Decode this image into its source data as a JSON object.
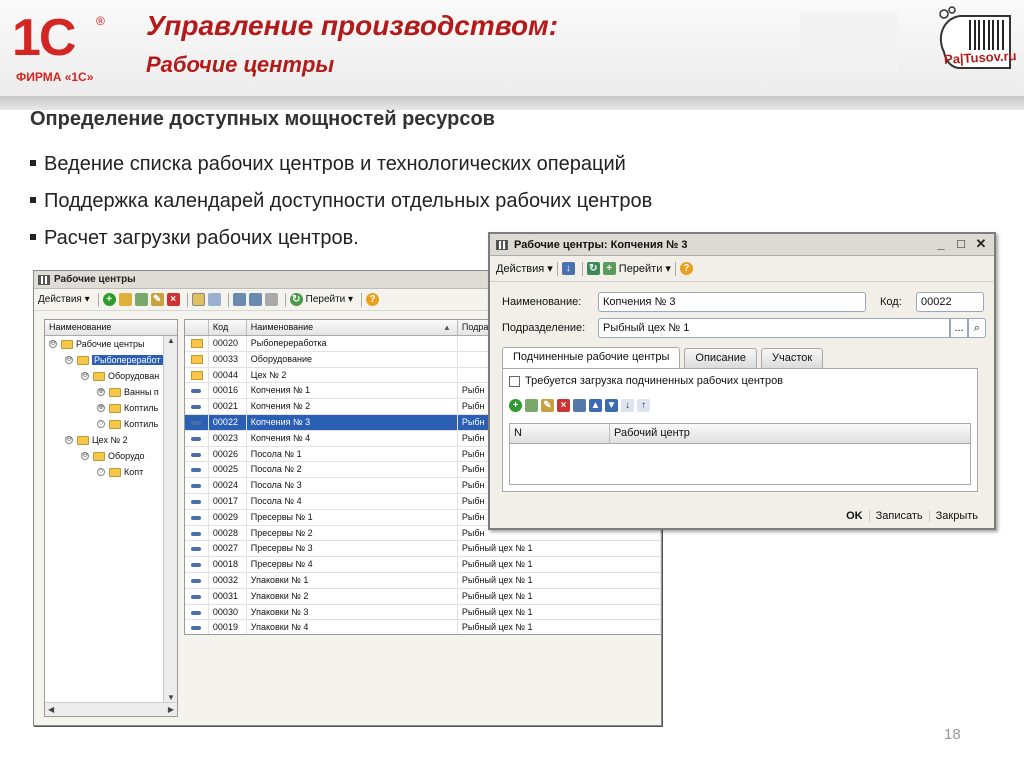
{
  "slide": {
    "logo_text": "1С",
    "logo_reg": "®",
    "logo_caption": "ФИРМА «1С»",
    "title": "Управление производством:",
    "subtitle": "Рабочие центры",
    "brand_text": "Pa|Tusov.ru",
    "section_title": "Определение доступных мощностей ресурсов",
    "bullets": [
      "Ведение списка рабочих центров и технологических операций",
      "Поддержка календарей доступности отдельных рабочих центров",
      "Расчет загрузки рабочих центров."
    ],
    "page_number": "18",
    "accent_color": "#b31b1b"
  },
  "list_window": {
    "title": "Рабочие центры",
    "toolbar": {
      "actions": "Действия",
      "goto": "Перейти"
    },
    "tree_header": "Наименование",
    "tree": [
      {
        "label": "Рабочие центры",
        "toggle": "⊖",
        "level": 0,
        "selected": false
      },
      {
        "label": "Рыбопереработ",
        "toggle": "⊖",
        "level": 1,
        "selected": true
      },
      {
        "label": "Оборудован",
        "toggle": "⊖",
        "level": 2,
        "selected": false
      },
      {
        "label": "Ванны п",
        "toggle": "⊕",
        "level": 3,
        "selected": false
      },
      {
        "label": "Коптиль",
        "toggle": "⊕",
        "level": 3,
        "selected": false
      },
      {
        "label": "Коптиль",
        "toggle": "○",
        "level": 3,
        "selected": false
      },
      {
        "label": "Цех № 2",
        "toggle": "⊖",
        "level": 1,
        "selected": false
      },
      {
        "label": "Оборудо",
        "toggle": "⊖",
        "level": 2,
        "selected": false
      },
      {
        "label": "Копт",
        "toggle": "○",
        "level": 3,
        "selected": false
      }
    ],
    "grid_headers": [
      "Код",
      "Наименование",
      "Подра"
    ],
    "rows": [
      {
        "icon": "folder",
        "code": "00020",
        "name": "Рыбопереработка",
        "division": ""
      },
      {
        "icon": "folder",
        "code": "00033",
        "name": "Оборудование",
        "division": ""
      },
      {
        "icon": "folder",
        "code": "00044",
        "name": "Цех № 2",
        "division": ""
      },
      {
        "icon": "item",
        "code": "00016",
        "name": "Копчения № 1",
        "division": "Рыбн"
      },
      {
        "icon": "item",
        "code": "00021",
        "name": "Копчения № 2",
        "division": "Рыбн"
      },
      {
        "icon": "item",
        "code": "00022",
        "name": "Копчения № 3",
        "division": "Рыбн",
        "selected": true
      },
      {
        "icon": "item",
        "code": "00023",
        "name": "Копчения № 4",
        "division": "Рыбн"
      },
      {
        "icon": "item",
        "code": "00026",
        "name": "Посола № 1",
        "division": "Рыбн"
      },
      {
        "icon": "item",
        "code": "00025",
        "name": "Посола № 2",
        "division": "Рыбн"
      },
      {
        "icon": "item",
        "code": "00024",
        "name": "Посола № 3",
        "division": "Рыбн"
      },
      {
        "icon": "item",
        "code": "00017",
        "name": "Посола № 4",
        "division": "Рыбн"
      },
      {
        "icon": "item",
        "code": "00029",
        "name": "Пресервы № 1",
        "division": "Рыбн"
      },
      {
        "icon": "item",
        "code": "00028",
        "name": "Пресервы № 2",
        "division": "Рыбн"
      },
      {
        "icon": "item",
        "code": "00027",
        "name": "Пресервы № 3",
        "division": "Рыбный цех № 1"
      },
      {
        "icon": "item",
        "code": "00018",
        "name": "Пресервы № 4",
        "division": "Рыбный цех № 1"
      },
      {
        "icon": "item",
        "code": "00032",
        "name": "Упаковки № 1",
        "division": "Рыбный цех № 1"
      },
      {
        "icon": "item",
        "code": "00031",
        "name": "Упаковки № 2",
        "division": "Рыбный цех № 1"
      },
      {
        "icon": "item",
        "code": "00030",
        "name": "Упаковки № 3",
        "division": "Рыбный цех № 1"
      },
      {
        "icon": "item",
        "code": "00019",
        "name": "Упаковки № 4",
        "division": "Рыбный цех № 1"
      }
    ]
  },
  "dialog": {
    "title": "Рабочие центры: Копчения № 3",
    "toolbar": {
      "actions": "Действия",
      "goto": "Перейти"
    },
    "name_label": "Наименование:",
    "name_value": "Копчения № 3",
    "code_label": "Код:",
    "code_value": "00022",
    "division_label": "Подразделение:",
    "division_value": "Рыбный цех № 1",
    "tabs": [
      "Подчиненные рабочие центры",
      "Описание",
      "Участок"
    ],
    "checkbox_label": "Требуется загрузка подчиненных рабочих центров",
    "sub_headers": [
      "N",
      "Рабочий центр"
    ],
    "buttons": {
      "ok": "OK",
      "save": "Записать",
      "close": "Закрыть"
    }
  }
}
